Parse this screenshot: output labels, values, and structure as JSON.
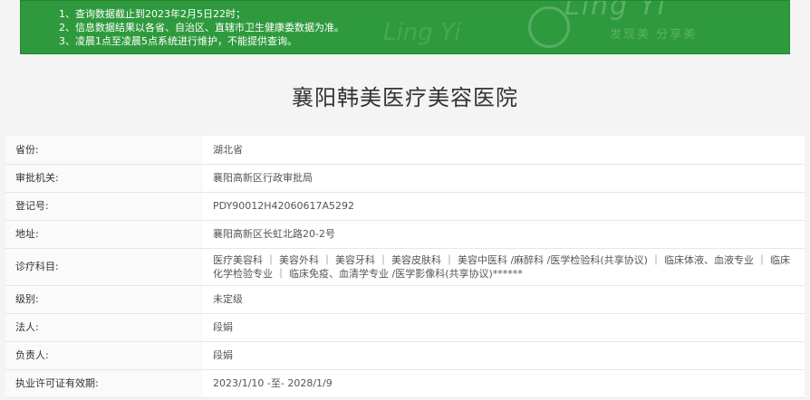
{
  "notice": {
    "lines": [
      "1、查询数据截止到2023年2月5日22时；",
      "2、信息数据结果以各省、自治区、直辖市卫生健康委数据为准。",
      "3、凌晨1点至凌晨5点系统进行维护，不能提供查询。"
    ],
    "watermark_logo": "Ling Yi",
    "watermark_slogan": "发现美 分享美",
    "watermark_faint": "Ling Yi"
  },
  "title": "襄阳韩美医疗美容医院",
  "details": [
    {
      "label": "省份:",
      "value": "湖北省"
    },
    {
      "label": "审批机关:",
      "value": "襄阳高新区行政审批局"
    },
    {
      "label": "登记号:",
      "value": "PDY90012H42060617A5292"
    },
    {
      "label": "地址:",
      "value": "襄阳高新区长虹北路20-2号"
    },
    {
      "label": "诊疗科目:",
      "value": "医疗美容科 ｜ 美容外科 ｜ 美容牙科 ｜ 美容皮肤科 ｜ 美容中医科 /麻醉科 /医学检验科(共享协议) ｜ 临床体液、血液专业 ｜ 临床化学检验专业 ｜ 临床免疫、血清学专业 /医学影像科(共享协议)******"
    },
    {
      "label": "级别:",
      "value": "未定级"
    },
    {
      "label": "法人:",
      "value": "段娟"
    },
    {
      "label": "负责人:",
      "value": "段娟"
    },
    {
      "label": "执业许可证有效期:",
      "value": "2023/1/10 -至- 2028/1/9"
    }
  ],
  "colors": {
    "notice_bg": "#2e9a3d",
    "page_bg": "#f4f4f4"
  }
}
